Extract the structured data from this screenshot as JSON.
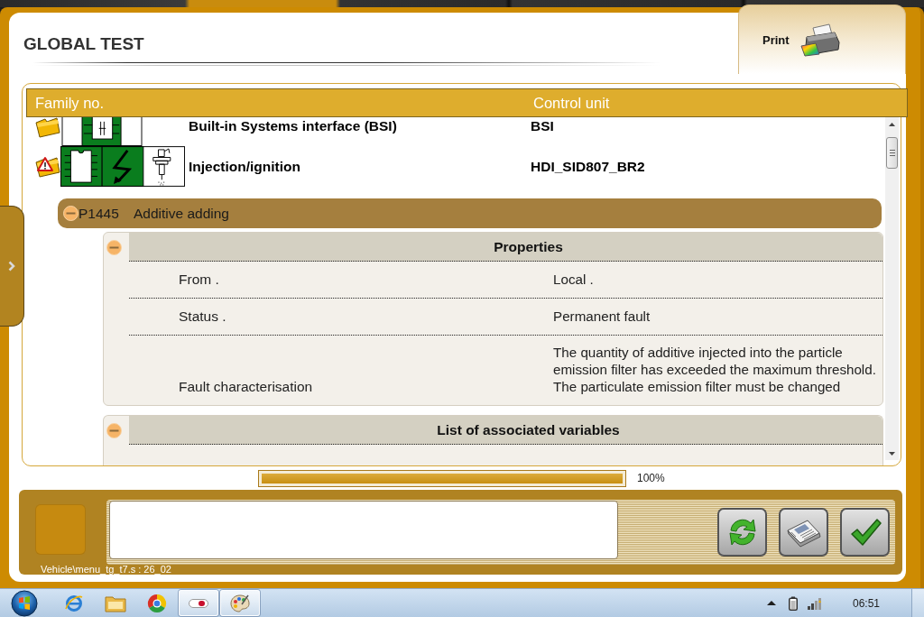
{
  "window": {
    "title": "GLOBAL TEST"
  },
  "print_button": {
    "label": "Print"
  },
  "table": {
    "columns": [
      "Family no.",
      "Control unit"
    ],
    "rows": [
      {
        "family": "Built-in Systems interface (BSI)",
        "control_unit": "BSI",
        "fault": false
      },
      {
        "family": "Injection/ignition",
        "control_unit": "HDI_SID807_BR2",
        "fault": true
      }
    ]
  },
  "fault": {
    "code": "P1445",
    "description": "Additive adding",
    "expanded": true,
    "sections": [
      {
        "title": "Properties",
        "expanded": true,
        "rows": [
          {
            "label": "From .",
            "value": "Local ."
          },
          {
            "label": "Status .",
            "value": "Permanent fault"
          },
          {
            "label": "Fault characterisation",
            "value": "The quantity of additive injected into the particle emission filter has exceeded the maximum threshold. The particulate emission filter must be changed"
          }
        ]
      },
      {
        "title": "List of associated variables",
        "expanded": true
      }
    ]
  },
  "progress": {
    "level": 1,
    "reading": "100%"
  },
  "status_path": "Vehicle\\menu_tg_t7.s : 26_02",
  "taskbar": {
    "apps": [
      {
        "running": false
      },
      {
        "running": false
      },
      {
        "running": false
      },
      {
        "running": true
      },
      {
        "running": true
      }
    ],
    "clock": "06:51"
  }
}
